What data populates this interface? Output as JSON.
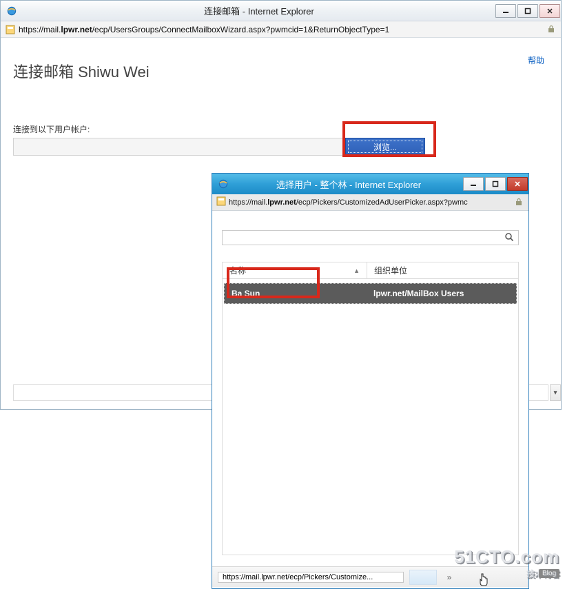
{
  "main": {
    "title": "连接邮箱 - Internet Explorer",
    "url_prefix": "https://mail.",
    "url_host": "lpwr.net",
    "url_path": "/ecp/UsersGroups/ConnectMailboxWizard.aspx?pwmcid=1&ReturnObjectType=1",
    "help_link": "帮助",
    "page_title": "连接邮箱 Shiwu Wei",
    "field_label": "连接到以下用户帐户:",
    "field_value": "",
    "browse_button": "浏览..."
  },
  "picker": {
    "title": "选择用户 - 整个林 - Internet Explorer",
    "url_prefix": "https://mail.",
    "url_host": "lpwr.net",
    "url_path": "/ecp/Pickers/CustomizedAdUserPicker.aspx?pwmc",
    "search_placeholder": "",
    "columns": {
      "name": "名称",
      "ou": "组织单位"
    },
    "rows": [
      {
        "name": "Ba Sun",
        "ou": "lpwr.net/MailBox Users"
      }
    ],
    "status_text": "https://mail.lpwr.net/ecp/Pickers/Customize..."
  },
  "watermark": {
    "line1": "51CTO.com",
    "line2": "技术博客",
    "tag": "Blog"
  }
}
